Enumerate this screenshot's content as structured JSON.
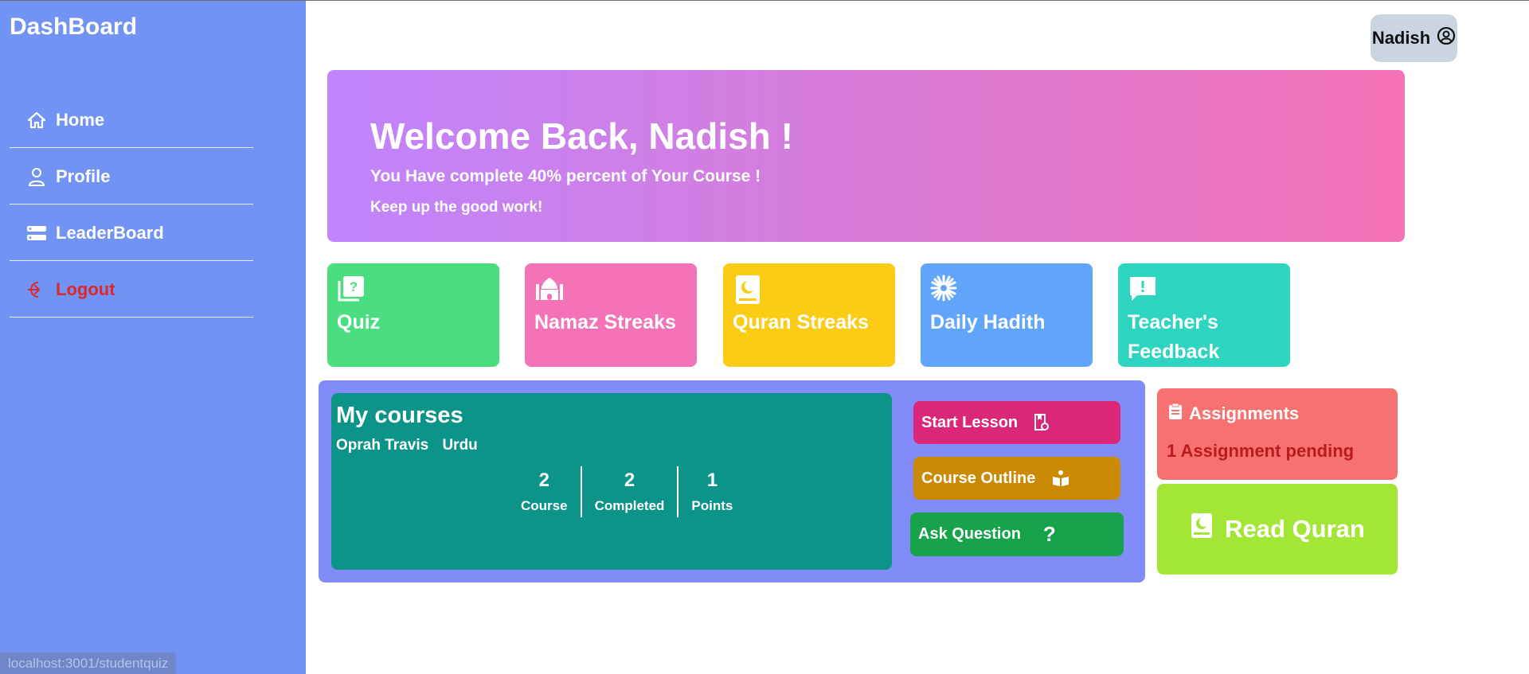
{
  "sidebar": {
    "brand": "DashBoard",
    "items": [
      {
        "label": "Home",
        "icon": "home-icon"
      },
      {
        "label": "Profile",
        "icon": "user-icon"
      },
      {
        "label": "LeaderBoard",
        "icon": "server-icon"
      },
      {
        "label": "Logout",
        "icon": "logout-icon"
      }
    ]
  },
  "user": {
    "name": "Nadish",
    "icon": "user-circle-icon"
  },
  "banner": {
    "title": "Welcome Back, Nadish !",
    "line1": "You Have complete 40% percent of Your Course !",
    "line2": "Keep up the good work!"
  },
  "tiles": [
    {
      "label": "Quiz",
      "color": "#4ade80",
      "icon": "quiz-book-icon"
    },
    {
      "label": "Namaz Streaks",
      "color": "#f472b6",
      "icon": "mosque-icon"
    },
    {
      "label": "Quran Streaks",
      "color": "#facc15",
      "icon": "quran-icon"
    },
    {
      "label": "Daily Hadith",
      "color": "#60a5fa",
      "icon": "starburst-icon"
    },
    {
      "label": "Teacher's Feedback",
      "color": "#2dd4bf",
      "icon": "feedback-icon"
    }
  ],
  "courses": {
    "title": "My courses",
    "teacher": "Oprah Travis",
    "language": "Urdu",
    "stats": [
      {
        "value": "2",
        "label": "Course"
      },
      {
        "value": "2",
        "label": "Completed"
      },
      {
        "value": "1",
        "label": "Points"
      }
    ],
    "actions": [
      {
        "label": "Start Lesson",
        "color": "#db2777",
        "icon": "lesson-icon"
      },
      {
        "label": "Course Outline",
        "color": "#ca8a04",
        "icon": "open-book-icon"
      },
      {
        "label": "Ask Question",
        "color": "#16a34a",
        "icon": "question-icon"
      }
    ]
  },
  "assignments": {
    "title": "Assignments",
    "pending": "1 Assignment pending",
    "icon": "clipboard-icon"
  },
  "read_quran": {
    "label": "Read Quran",
    "icon": "quran-icon"
  },
  "status_url": "localhost:3001/studentquiz"
}
